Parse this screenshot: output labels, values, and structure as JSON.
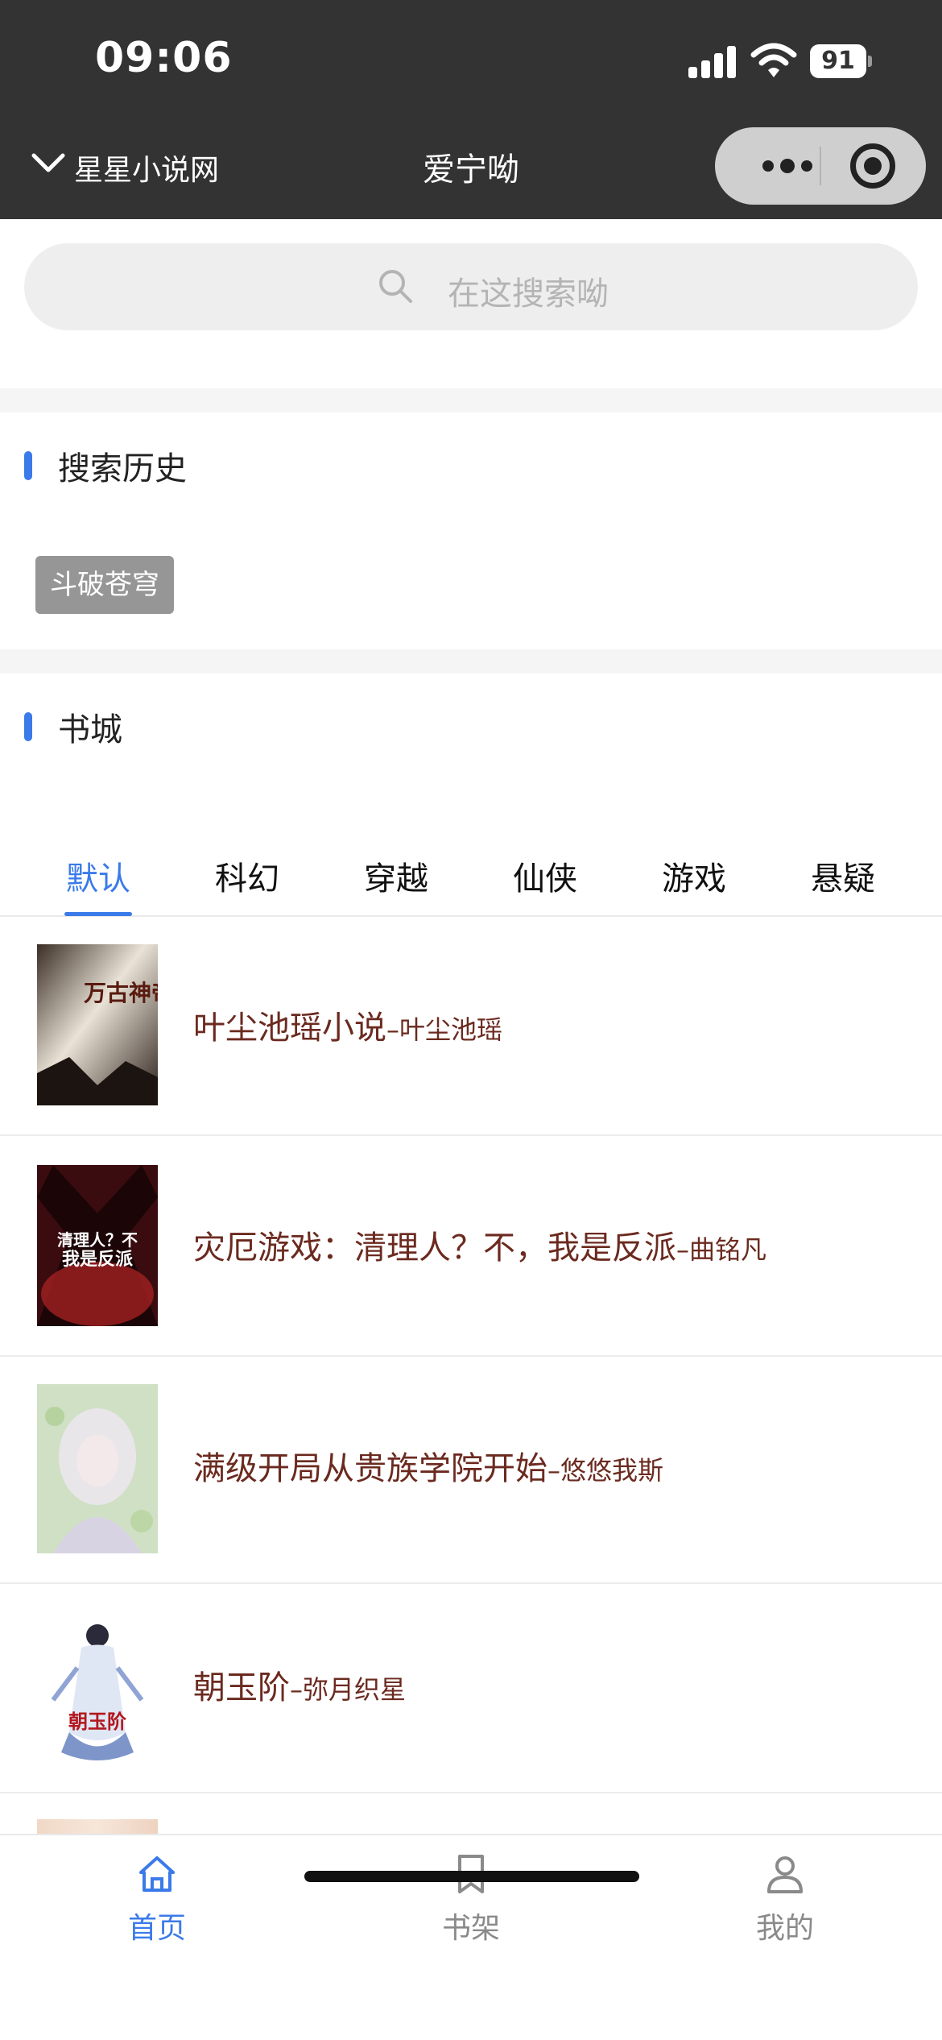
{
  "status_bar": {
    "time": "09:06",
    "battery": "91",
    "icons": [
      "signal-icon",
      "wifi-icon",
      "battery-icon"
    ]
  },
  "nav": {
    "back_icon": "chevron-down-icon",
    "site_name": "星星小说网",
    "title": "爱宁呦",
    "capsule_icons": [
      "more-dots-icon",
      "close-target-icon"
    ]
  },
  "search": {
    "icon": "search-icon",
    "placeholder": "在这搜索呦"
  },
  "history": {
    "title": "搜索历史",
    "tags": [
      "斗破苍穹"
    ]
  },
  "bookstore": {
    "title": "书城",
    "tabs": [
      "默认",
      "科幻",
      "穿越",
      "仙侠",
      "游戏",
      "悬疑"
    ],
    "active_tab": "默认",
    "books": [
      {
        "title": "叶尘池瑶小说",
        "author": "叶尘池瑶"
      },
      {
        "title": "灾厄游戏：清理人？不，我是反派",
        "author": "曲铭凡"
      },
      {
        "title": "满级开局从贵族学院开始",
        "author": "悠悠我斯"
      },
      {
        "title": "朝玉阶",
        "author": "弥月织星"
      }
    ],
    "separator": "–"
  },
  "cover_texts": {
    "book1": "万古神帝",
    "book2_line1": "清理人？不",
    "book2_line2": "我是反派",
    "book4": "朝玉阶"
  },
  "bottom_nav": {
    "items": [
      {
        "label": "首页",
        "icon": "home-icon",
        "active": true
      },
      {
        "label": "书架",
        "icon": "bookmark-icon",
        "active": false
      },
      {
        "label": "我的",
        "icon": "user-icon",
        "active": false
      }
    ]
  },
  "colors": {
    "accent": "#3b7ae9",
    "header_bg": "#333333",
    "book_title": "#6b2a1f",
    "tag_bg": "#969696"
  }
}
